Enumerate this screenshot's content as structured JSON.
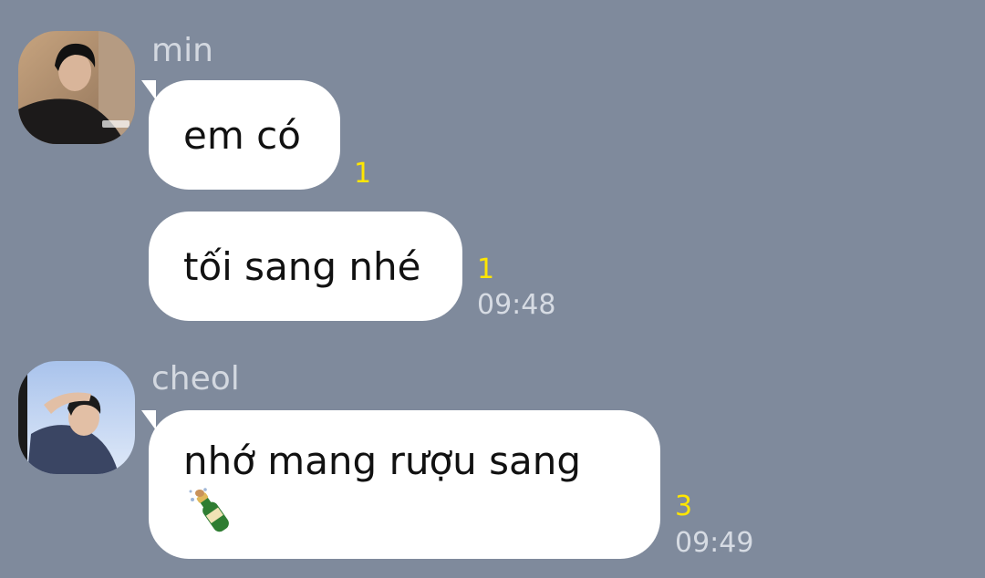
{
  "chat": {
    "groups": [
      {
        "sender": "min",
        "avatar_icon": "avatar-photo-min",
        "messages": [
          {
            "text": "em có",
            "read_count": "1",
            "time": ""
          },
          {
            "text": "tối sang nhé",
            "read_count": "1",
            "time": "09:48"
          }
        ]
      },
      {
        "sender": "cheol",
        "avatar_icon": "avatar-photo-cheol",
        "messages": [
          {
            "text": "nhớ mang rượu sang",
            "emoji": "bottle-with-popping-cork-icon",
            "read_count": "3",
            "time": "09:49"
          }
        ]
      }
    ]
  },
  "colors": {
    "background": "#7f8a9c",
    "bubble": "#ffffff",
    "read_count": "#ffe600",
    "timestamp": "#d6dbe3",
    "sender_name": "#d3d8e0"
  }
}
